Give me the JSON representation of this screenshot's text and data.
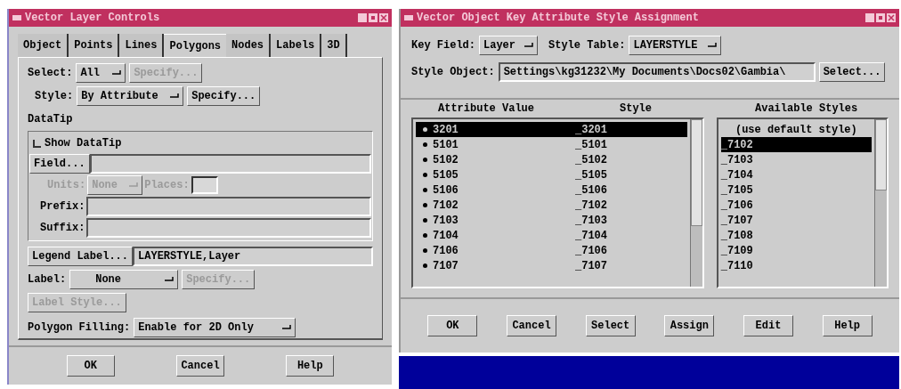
{
  "left_window": {
    "title": "Vector Layer Controls",
    "tabs": [
      {
        "label": "Object",
        "selected": false
      },
      {
        "label": "Points",
        "selected": false
      },
      {
        "label": "Lines",
        "selected": false
      },
      {
        "label": "Polygons",
        "selected": true
      },
      {
        "label": "Nodes",
        "selected": false
      },
      {
        "label": "Labels",
        "selected": false
      },
      {
        "label": "3D",
        "selected": false
      }
    ],
    "select": {
      "label": "Select:",
      "value": "All",
      "button": {
        "label": "Specify...",
        "disabled": true
      }
    },
    "style": {
      "label": "Style:",
      "value": "By Attribute",
      "button": {
        "label": "Specify...",
        "disabled": false
      }
    },
    "datatip": {
      "heading": "DataTip",
      "show": {
        "label": "Show DataTip",
        "checked": false
      },
      "field_button": "Field...",
      "units": {
        "label": "Units:",
        "value": "None",
        "disabled": true
      },
      "places": {
        "label": "Places:",
        "disabled": true
      },
      "prefix_label": "Prefix:",
      "suffix_label": "Suffix:"
    },
    "legend": {
      "button": "Legend Label...",
      "value": "LAYERSTYLE,Layer"
    },
    "label_row": {
      "label": "Label:",
      "value": "None",
      "button": {
        "label": "Specify...",
        "disabled": true
      }
    },
    "label_style": {
      "label": "Label Style...",
      "disabled": true
    },
    "polygon_filling": {
      "label": "Polygon Filling:",
      "value": "Enable for 2D Only"
    },
    "buttons": [
      "OK",
      "Cancel",
      "Help"
    ]
  },
  "right_window": {
    "title": "Vector Object Key Attribute Style Assignment",
    "key_field": {
      "label": "Key Field:",
      "value": "Layer"
    },
    "style_table": {
      "label": "Style Table:",
      "value": "LAYERSTYLE"
    },
    "style_object": {
      "label": "Style Object:",
      "value": "Settings\\kg31232\\My Documents\\Docs02\\Gambia\\",
      "button": "Select..."
    },
    "columns": [
      "Attribute Value",
      "Style",
      "Available Styles"
    ],
    "rows": [
      {
        "value": "3201",
        "style": "_3201",
        "selected": true
      },
      {
        "value": "5101",
        "style": "_5101",
        "selected": false
      },
      {
        "value": "5102",
        "style": "_5102",
        "selected": false
      },
      {
        "value": "5105",
        "style": "_5105",
        "selected": false
      },
      {
        "value": "5106",
        "style": "_5106",
        "selected": false
      },
      {
        "value": "7102",
        "style": "_7102",
        "selected": false
      },
      {
        "value": "7103",
        "style": "_7103",
        "selected": false
      },
      {
        "value": "7104",
        "style": "_7104",
        "selected": false
      },
      {
        "value": "7106",
        "style": "_7106",
        "selected": false
      },
      {
        "value": "7107",
        "style": "_7107",
        "selected": false
      }
    ],
    "available": [
      {
        "label": "(use default style)",
        "selected": false
      },
      {
        "label": "_7102",
        "selected": true
      },
      {
        "label": "_7103",
        "selected": false
      },
      {
        "label": "_7104",
        "selected": false
      },
      {
        "label": "_7105",
        "selected": false
      },
      {
        "label": "_7106",
        "selected": false
      },
      {
        "label": "_7107",
        "selected": false
      },
      {
        "label": "_7108",
        "selected": false
      },
      {
        "label": "_7109",
        "selected": false
      },
      {
        "label": "_7110",
        "selected": false
      }
    ],
    "buttons": [
      "OK",
      "Cancel",
      "Select",
      "Assign",
      "Edit",
      "Help"
    ]
  }
}
